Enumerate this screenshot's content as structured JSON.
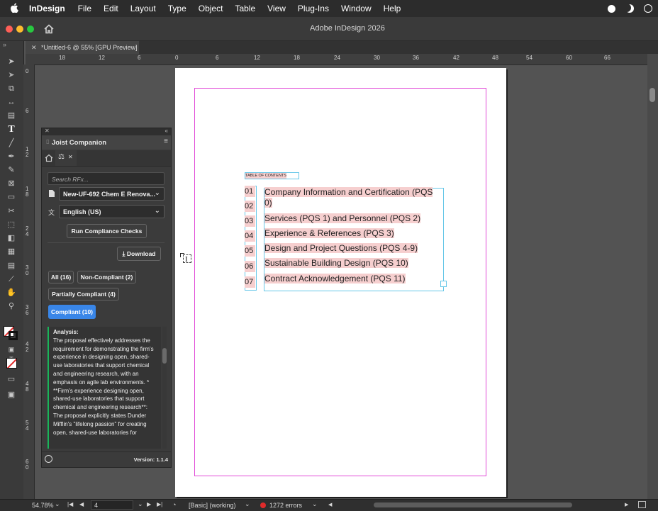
{
  "menubar": {
    "app": "InDesign",
    "items": [
      "File",
      "Edit",
      "Layout",
      "Type",
      "Object",
      "Table",
      "View",
      "Plug-Ins",
      "Window",
      "Help"
    ]
  },
  "window": {
    "title": "Adobe InDesign 2026"
  },
  "document_tab": {
    "label": "*Untitled-6 @ 55% [GPU Preview]"
  },
  "rulers": {
    "horizontal": [
      "18",
      "12",
      "6",
      "0",
      "6",
      "12",
      "18",
      "24",
      "30",
      "36",
      "42",
      "48",
      "54",
      "60",
      "66"
    ],
    "vertical": [
      "0",
      "6",
      "1\n2",
      "1\n8",
      "2\n4",
      "3\n0",
      "3\n6",
      "4\n2",
      "4\n8",
      "5\n4",
      "6\n0"
    ]
  },
  "panel": {
    "title": "Joist Companion",
    "search_placeholder": "Search RFx...",
    "document_select": "New-UF-692 Chem E Renova...",
    "language_select": "English (US)",
    "run_button": "Run Compliance Checks",
    "download_button": "Download",
    "filters": {
      "all": "All (16)",
      "non_compliant": "Non-Compliant (2)",
      "partial": "Partially Compliant (4)",
      "compliant": "Compliant (10)"
    },
    "analysis_heading": "Analysis:",
    "analysis_text": "The proposal effectively addresses the requirement for demonstrating the firm's experience in designing open, shared-use laboratories that support chemical and engineering research, with an emphasis on agile lab environments. * **Firm's experience designing open, shared-use laboratories that support chemical and engineering research**: The proposal explicitly states Dunder Mifflin's \"lifelong passion\" for creating open, shared-use laboratories for",
    "version": "Version: 1.1.4"
  },
  "document": {
    "toc_heading": "TABLE OF CONTENTS",
    "toc": [
      {
        "num": "01",
        "text": "Company Information and Certification (PQS 0)"
      },
      {
        "num": "02",
        "text": "Services (PQS 1) and Personnel (PQS 2)"
      },
      {
        "num": "03",
        "text": "Experience & References (PQS 3)"
      },
      {
        "num": "04",
        "text": "Design and Project Questions (PQS 4-9)"
      },
      {
        "num": "05",
        "text": "Sustainable Building Design (PQS 10)"
      },
      {
        "num": "06",
        "text": "Contract Acknowledgement (PQS 11)"
      },
      {
        "num": "07",
        "text": ""
      }
    ]
  },
  "statusbar": {
    "zoom": "54.78%",
    "page": "4",
    "preflight_profile": "[Basic] (working)",
    "errors": "1272 errors"
  },
  "colors": {
    "accent_blue": "#3986e8",
    "compliant_green": "#19b55a",
    "highlight_pink": "#f6cfcf",
    "margin_magenta": "#e14ad7",
    "error_red": "#e02b2b"
  }
}
